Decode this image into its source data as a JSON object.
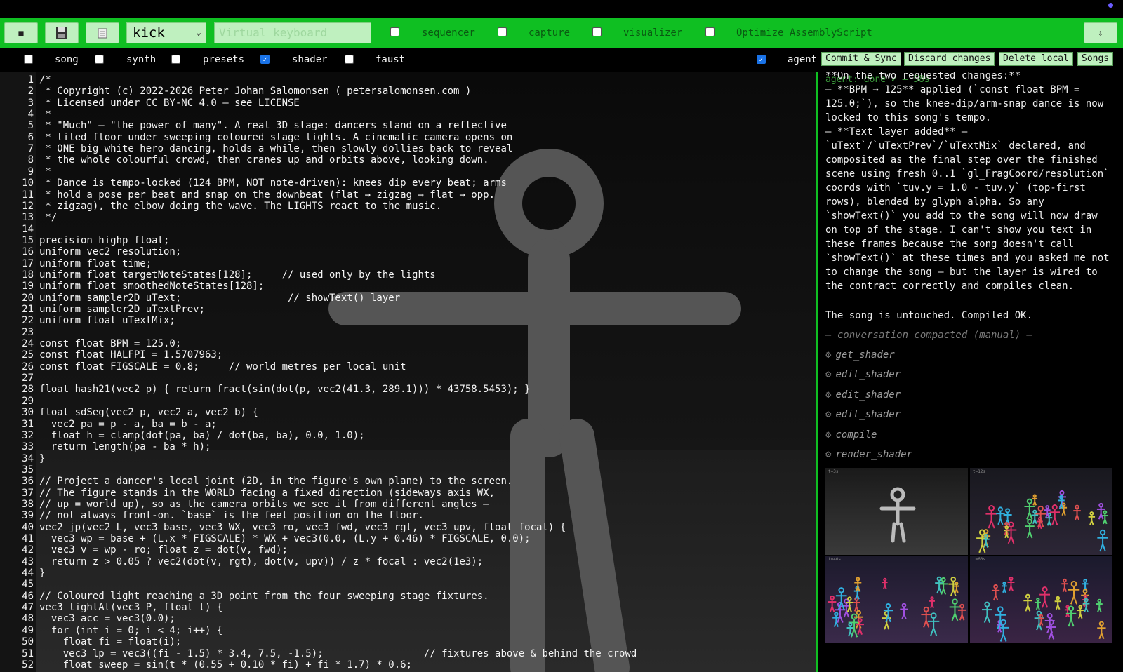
{
  "toolbar": {
    "stop_label": "■",
    "preset_select": "kick",
    "keyboard_placeholder": "Virtual keyboard",
    "toggles": [
      {
        "label": "sequencer",
        "checked": true
      },
      {
        "label": "capture",
        "checked": true
      },
      {
        "label": "visualizer",
        "checked": false
      },
      {
        "label": "Optimize AssemblyScript",
        "checked": true
      }
    ],
    "download_label": "⇩"
  },
  "panels_row": {
    "toggles": [
      {
        "label": "song",
        "checked": false
      },
      {
        "label": "synth",
        "checked": false
      },
      {
        "label": "presets",
        "checked": false
      },
      {
        "label": "shader",
        "checked": true
      },
      {
        "label": "faust",
        "checked": false
      }
    ],
    "agent": {
      "label": "agent",
      "checked": true
    },
    "buttons": [
      "Commit & Sync",
      "Discard changes",
      "Delete local",
      "Songs"
    ]
  },
  "editor": {
    "lines": [
      "/*",
      " * Copyright (c) 2022-2026 Peter Johan Salomonsen ( petersalomonsen.com )",
      " * Licensed under CC BY-NC 4.0 — see LICENSE",
      " *",
      " * \"Much\" — \"the power of many\". A real 3D stage: dancers stand on a reflective",
      " * tiled floor under sweeping coloured stage lights. A cinematic camera opens on",
      " * ONE big white hero dancing, holds a while, then slowly dollies back to reveal",
      " * the whole colourful crowd, then cranes up and orbits above, looking down.",
      " *",
      " * Dance is tempo-locked (124 BPM, NOT note-driven): knees dip every beat; arms",
      " * hold a pose per beat and snap on the downbeat (flat → zigzag → flat → opp.",
      " * zigzag), the elbow doing the wave. The LIGHTS react to the music.",
      " */",
      "",
      "precision highp float;",
      "uniform vec2 resolution;",
      "uniform float time;",
      "uniform float targetNoteStates[128];     // used only by the lights",
      "uniform float smoothedNoteStates[128];",
      "uniform sampler2D uText;                  // showText() layer",
      "uniform sampler2D uTextPrev;",
      "uniform float uTextMix;",
      "",
      "const float BPM = 125.0;",
      "const float HALFPI = 1.5707963;",
      "const float FIGSCALE = 0.8;     // world metres per local unit",
      "",
      "float hash21(vec2 p) { return fract(sin(dot(p, vec2(41.3, 289.1))) * 43758.5453); }",
      "",
      "float sdSeg(vec2 p, vec2 a, vec2 b) {",
      "  vec2 pa = p - a, ba = b - a;",
      "  float h = clamp(dot(pa, ba) / dot(ba, ba), 0.0, 1.0);",
      "  return length(pa - ba * h);",
      "}",
      "",
      "// Project a dancer's local joint (2D, in the figure's own plane) to the screen.",
      "// The figure stands in the WORLD facing a fixed direction (sideways axis WX,",
      "// up = world up), so as the camera orbits we see it from different angles —",
      "// not always front-on. `base` is the feet position on the floor.",
      "vec2 jp(vec2 L, vec3 base, vec3 WX, vec3 ro, vec3 fwd, vec3 rgt, vec3 upv, float focal) {",
      "  vec3 wp = base + (L.x * FIGSCALE) * WX + vec3(0.0, (L.y + 0.46) * FIGSCALE, 0.0);",
      "  vec3 v = wp - ro; float z = dot(v, fwd);",
      "  return z > 0.05 ? vec2(dot(v, rgt), dot(v, upv)) / z * focal : vec2(1e3);",
      "}",
      "",
      "// Coloured light reaching a 3D point from the four sweeping stage fixtures.",
      "vec3 lightAt(vec3 P, float t) {",
      "  vec3 acc = vec3(0.0);",
      "  for (int i = 0; i < 4; i++) {",
      "    float fi = float(i);",
      "    vec3 lp = vec3((fi - 1.5) * 3.4, 7.5, -1.5);                 // fixtures above & behind the crowd",
      "    float sweep = sin(t * (0.55 + 0.10 * fi) + fi * 1.7) * 0.6;"
    ]
  },
  "agent_panel": {
    "status": "agent: done ✓ — 58s",
    "message_lines": [
      "**On the two requested changes:**",
      "– **BPM → 125** applied (`const float BPM =",
      "125.0;`), so the knee-dip/arm-snap dance is now",
      "locked to this song's tempo.",
      "– **Text layer added** —",
      "`uText`/`uTextPrev`/`uTextMix` declared, and",
      "composited as the final step over the finished",
      "scene using fresh 0..1 `gl_FragCoord/resolution`",
      "coords with `tuv.y = 1.0 - tuv.y` (top-first",
      "rows), blended by glyph alpha. So any",
      "`showText()` you add to the song will now draw",
      "on top of the stage. I can't show you text in",
      "these frames because the song doesn't call",
      "`showText()` at these times and you asked me not",
      "to change the song — but the layer is wired to",
      "the contract correctly and compiles clean."
    ],
    "summary": "The song is untouched. Compiled OK.",
    "compacted": "— conversation compacted (manual) —",
    "tool_calls": [
      "get_shader",
      "edit_shader",
      "edit_shader",
      "edit_shader",
      "compile",
      "render_shader"
    ],
    "frame_labels": [
      "t=3s",
      "t=12s",
      "t=40s",
      "t=60s"
    ]
  },
  "colors": {
    "toolbar_green": "#0fbf22",
    "button_bg": "#bff0bf",
    "checkbox_blue": "#1a73e8"
  }
}
